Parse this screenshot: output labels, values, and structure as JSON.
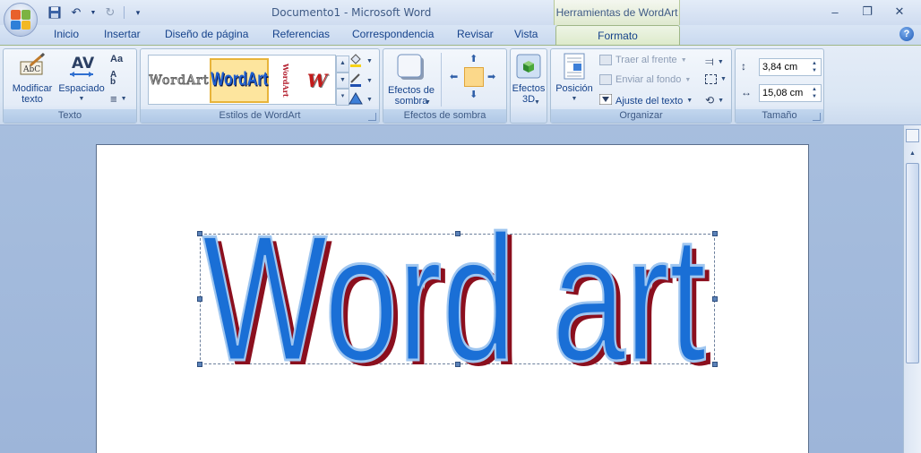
{
  "window": {
    "title": "Documento1 - Microsoft Word",
    "contextual_title": "Herramientas de WordArt"
  },
  "quick_access": {
    "icons": [
      "save-icon",
      "undo-icon",
      "redo-icon",
      "customize-icon"
    ]
  },
  "tabs": [
    {
      "label": "Inicio"
    },
    {
      "label": "Insertar"
    },
    {
      "label": "Diseño de página"
    },
    {
      "label": "Referencias"
    },
    {
      "label": "Correspondencia"
    },
    {
      "label": "Revisar"
    },
    {
      "label": "Vista"
    },
    {
      "label": "Formato",
      "active": true
    }
  ],
  "ribbon": {
    "texto": {
      "label": "Texto",
      "modificar": "Modificar texto",
      "espaciado": "Espaciado"
    },
    "estilos": {
      "label": "Estilos de WordArt",
      "gallery": [
        "WordArt",
        "WordArt",
        "WordArt",
        "W"
      ]
    },
    "sombra": {
      "label": "Efectos de sombra",
      "efectos": "Efectos de sombra"
    },
    "efectos3d": {
      "label": "Efectos 3D"
    },
    "organizar": {
      "label": "Organizar",
      "posicion": "Posición",
      "traer": "Traer al frente",
      "enviar": "Enviar al fondo",
      "ajuste": "Ajuste del texto"
    },
    "tamano": {
      "label": "Tamaño",
      "height": "3,84 cm",
      "width": "15,08 cm"
    }
  },
  "document": {
    "wordart_text": "Word art"
  },
  "colors": {
    "wordart_fill": "#1a6fd6",
    "wordart_shadow": "#8b0f1e",
    "wordart_outline": "#9fc6f0",
    "contextual_tab": "#dbe9c8"
  }
}
